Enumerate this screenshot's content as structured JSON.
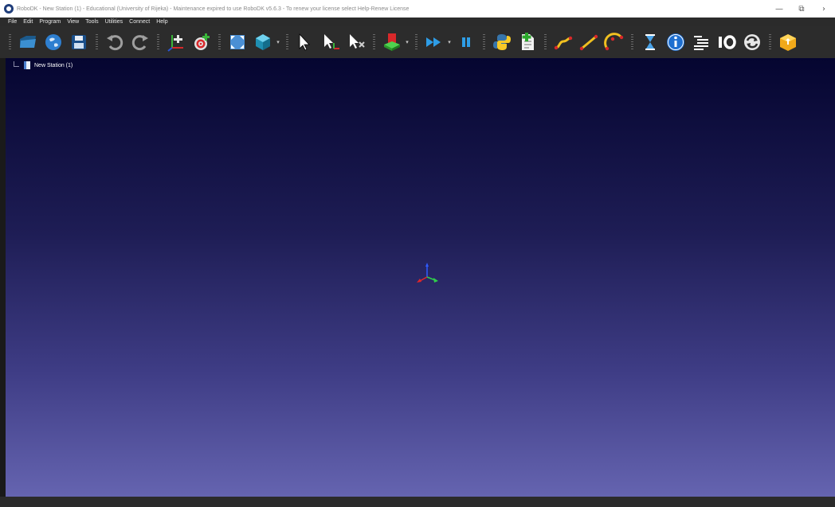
{
  "window": {
    "title": "RoboDK - New Station (1) - Educational (University of Rijeka) - Maintenance expired to use RoboDK v5.6.3 - To renew your license select Help-Renew License",
    "minimize": "—",
    "restore": "⧉",
    "more": "›"
  },
  "menu": {
    "items": [
      "File",
      "Edit",
      "Program",
      "View",
      "Tools",
      "Utilities",
      "Connect",
      "Help"
    ]
  },
  "toolbar": {
    "icons": [
      "open-folder-icon",
      "online-library-icon",
      "save-icon",
      "undo-icon",
      "redo-icon",
      "add-reference-frame-icon",
      "add-target-icon",
      "fit-all-icon",
      "iso-view-icon",
      "select-icon",
      "move-reference-icon",
      "move-tool-icon",
      "collision-check-icon",
      "fast-simulation-icon",
      "pause-icon",
      "python-program-icon",
      "add-program-icon",
      "joint-move-icon",
      "linear-move-icon",
      "circular-move-icon",
      "pause-instruction-icon",
      "message-icon",
      "program-call-icon",
      "io-icon",
      "rotate-icon",
      "export-icon"
    ]
  },
  "tree": {
    "root_label": "New Station (1)"
  },
  "colors": {
    "viewport_top": "#050530",
    "viewport_bottom": "#6564b0",
    "toolbar_bg": "#2c2c2c"
  }
}
